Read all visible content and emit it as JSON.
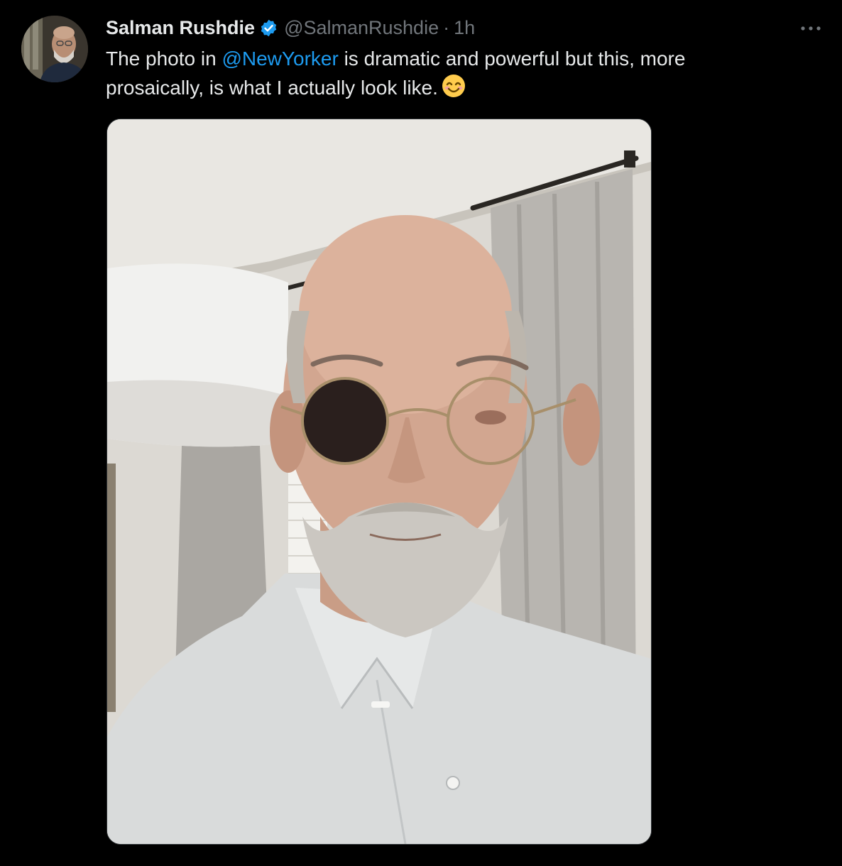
{
  "author": {
    "display_name": "Salman Rushdie",
    "handle": "@SalmanRushdie",
    "separator": "·",
    "time": "1h",
    "verified": true,
    "avatar_icon": "author-avatar"
  },
  "tweet": {
    "text_before": "The photo in ",
    "mention": "@NewYorker",
    "text_after_line1": " is dramatic and powerful but this, more",
    "text_line2": "prosaically, is what I actually look like.",
    "emoji": "smiling-face-with-smiling-eyes"
  },
  "menu": {
    "icon": "more-options-icon"
  },
  "colors": {
    "background": "#000000",
    "text": "#e7e9ea",
    "secondary": "#71767b",
    "link": "#1d9bf0",
    "verified": "#1d9bf0"
  }
}
